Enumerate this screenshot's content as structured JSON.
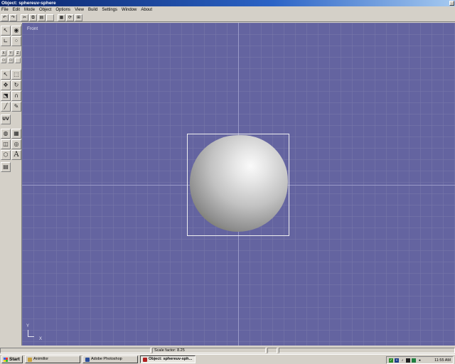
{
  "window": {
    "title": "Object: sphereuv-sphere"
  },
  "menu": [
    "File",
    "Edit",
    "Mode",
    "Object",
    "Options",
    "View",
    "Build",
    "Settings",
    "Window",
    "About"
  ],
  "toolbar_icons": [
    "undo-icon",
    "redo-icon",
    "cut-icon",
    "copy-icon",
    "paste-icon",
    "blank-icon",
    "grid-view-icon",
    "rotate-view-icon",
    "arrange-icon"
  ],
  "viewport": {
    "label": "Front",
    "axis_x": "X",
    "axis_y": "Y",
    "background_color": "#6464a0"
  },
  "left_tools": {
    "xyz_labels": [
      "X",
      "Y",
      "Z"
    ],
    "uv_label": "UV",
    "text_tool_label": "A"
  },
  "status": {
    "scale_factor": "Scale factor: 8.25"
  },
  "taskbar": {
    "start_label": "Start",
    "tasks": [
      "Animillor",
      "Adobe Photoshop",
      "Object: sphereuv-sph..."
    ],
    "clock": "11:55 AM"
  }
}
